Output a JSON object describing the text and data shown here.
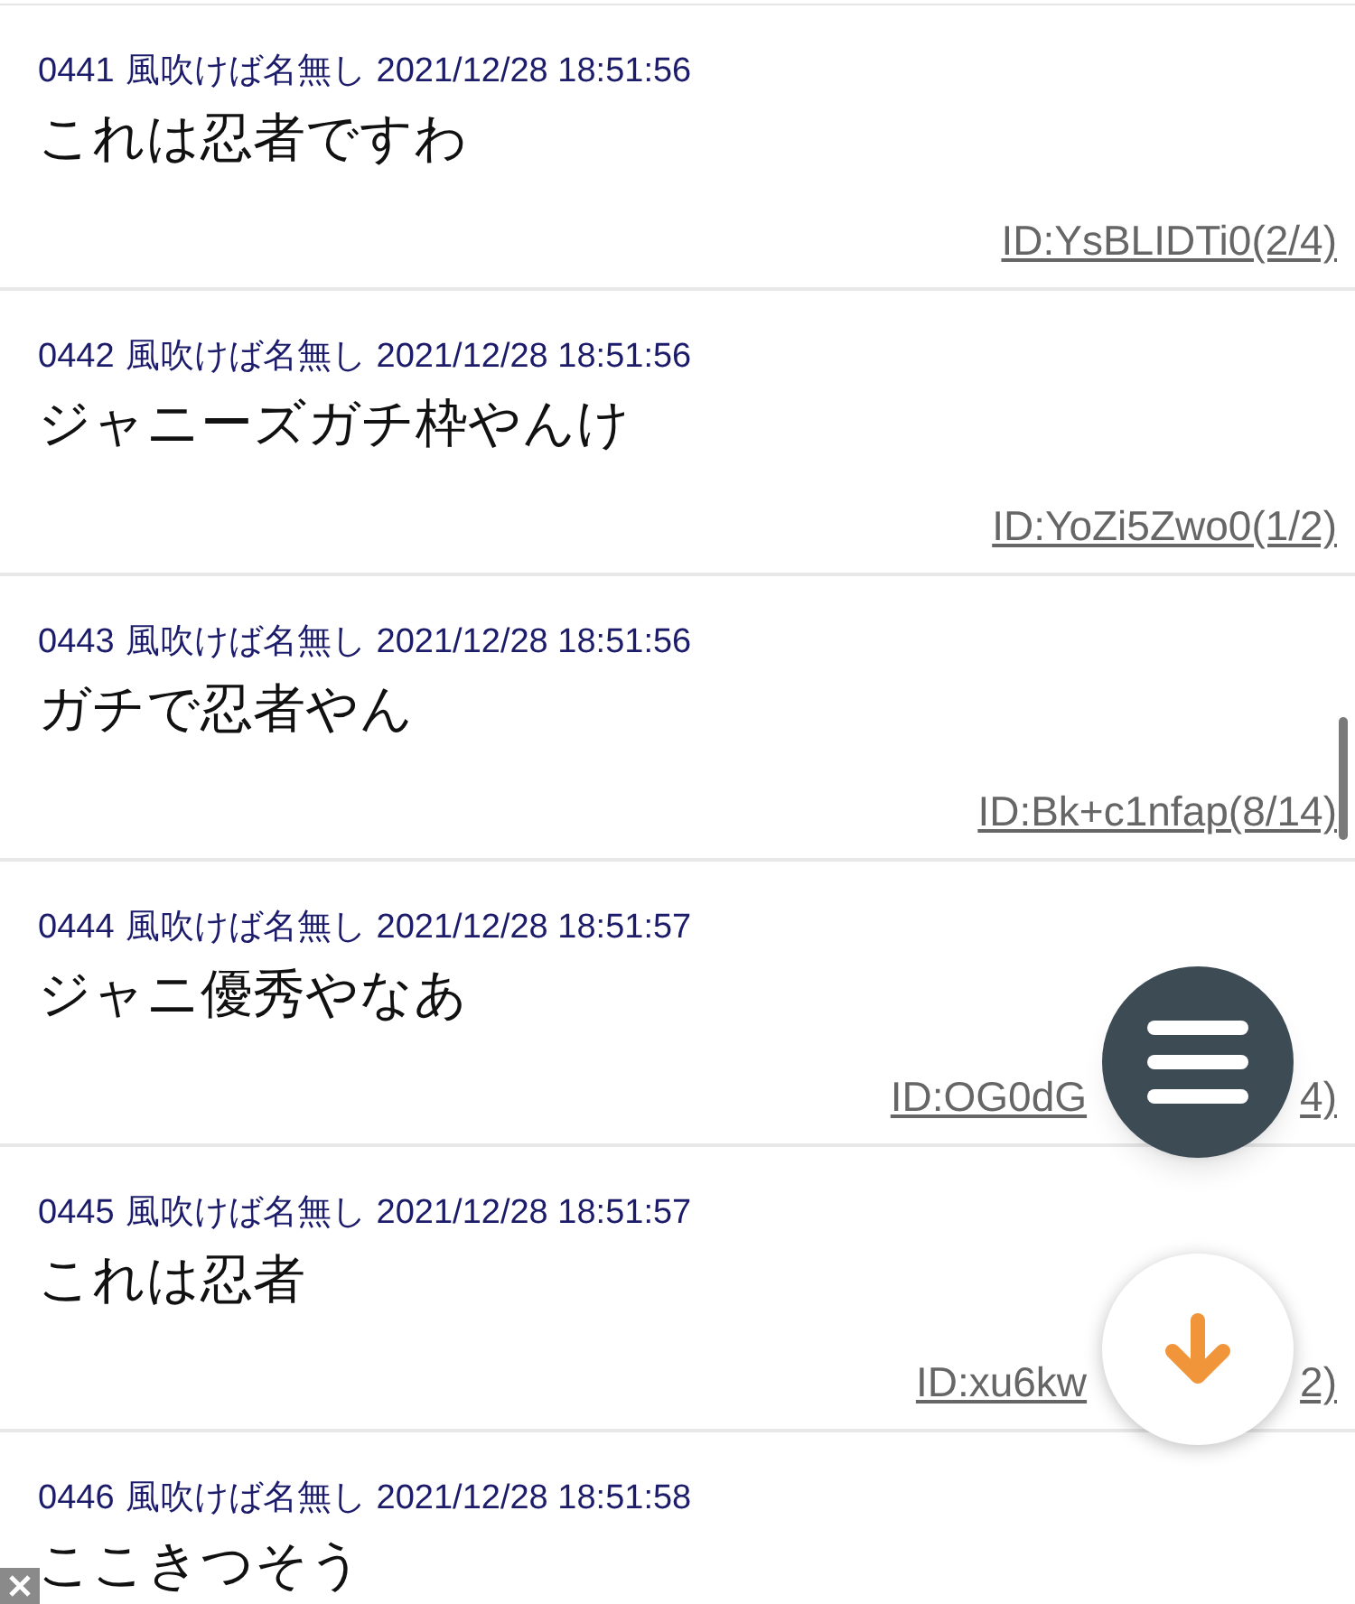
{
  "posts": [
    {
      "number": "0441",
      "name": "風吹けば名無し",
      "datetime": "2021/12/28 18:51:56",
      "message": "これは忍者ですわ",
      "id": [
        "ID:YsBLIDTi0(2/4)"
      ]
    },
    {
      "number": "0442",
      "name": "風吹けば名無し",
      "datetime": "2021/12/28 18:51:56",
      "message": "ジャニーズガチ枠やんけ",
      "id": [
        "ID:YoZi5Zwo0(1/2)"
      ]
    },
    {
      "number": "0443",
      "name": "風吹けば名無し",
      "datetime": "2021/12/28 18:51:56",
      "message": "ガチで忍者やん",
      "id": [
        "ID:Bk+c1nfap(8/14)"
      ]
    },
    {
      "number": "0444",
      "name": "風吹けば名無し",
      "datetime": "2021/12/28 18:51:57",
      "message": "ジャニ優秀やなあ",
      "id": [
        "ID:OG0dG",
        "4)"
      ]
    },
    {
      "number": "0445",
      "name": "風吹けば名無し",
      "datetime": "2021/12/28 18:51:57",
      "message": "これは忍者",
      "id": [
        "ID:xu6kw",
        "2)"
      ]
    },
    {
      "number": "0446",
      "name": "風吹けば名無し",
      "datetime": "2021/12/28 18:51:58",
      "message": "ここきつそう"
    }
  ]
}
